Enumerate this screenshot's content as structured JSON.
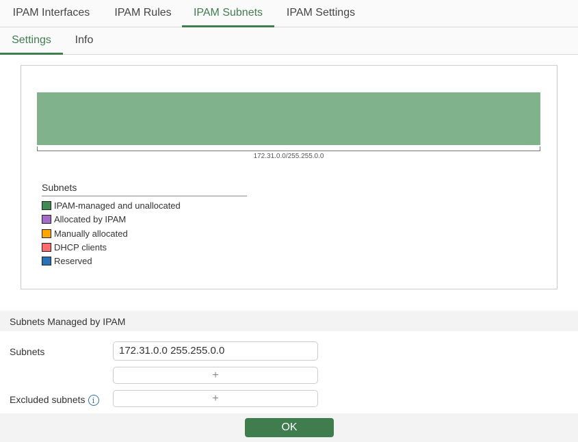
{
  "tabs": [
    {
      "label": "IPAM Interfaces"
    },
    {
      "label": "IPAM Rules"
    },
    {
      "label": "IPAM Subnets"
    },
    {
      "label": "IPAM Settings"
    }
  ],
  "subtabs": [
    {
      "label": "Settings"
    },
    {
      "label": "Info"
    }
  ],
  "chart": {
    "bar_label": "172.31.0.0/255.255.0.0",
    "bar_color": "#80b38c",
    "legend_title": "Subnets",
    "legend": [
      {
        "label": "IPAM-managed and unallocated",
        "color": "#3f8a55"
      },
      {
        "label": "Allocated by IPAM",
        "color": "#a56bc8"
      },
      {
        "label": "Manually allocated",
        "color": "#ffa500"
      },
      {
        "label": "DHCP clients",
        "color": "#ff6b6b"
      },
      {
        "label": "Reserved",
        "color": "#2a72b8"
      }
    ]
  },
  "section": {
    "title": "Subnets Managed by IPAM",
    "subnets_label": "Subnets",
    "subnets_value": "172.31.0.0 255.255.0.0",
    "excluded_label": "Excluded subnets",
    "add": "+",
    "info": "i"
  },
  "footer": {
    "ok": "OK"
  },
  "accent": "#3f7d4f"
}
